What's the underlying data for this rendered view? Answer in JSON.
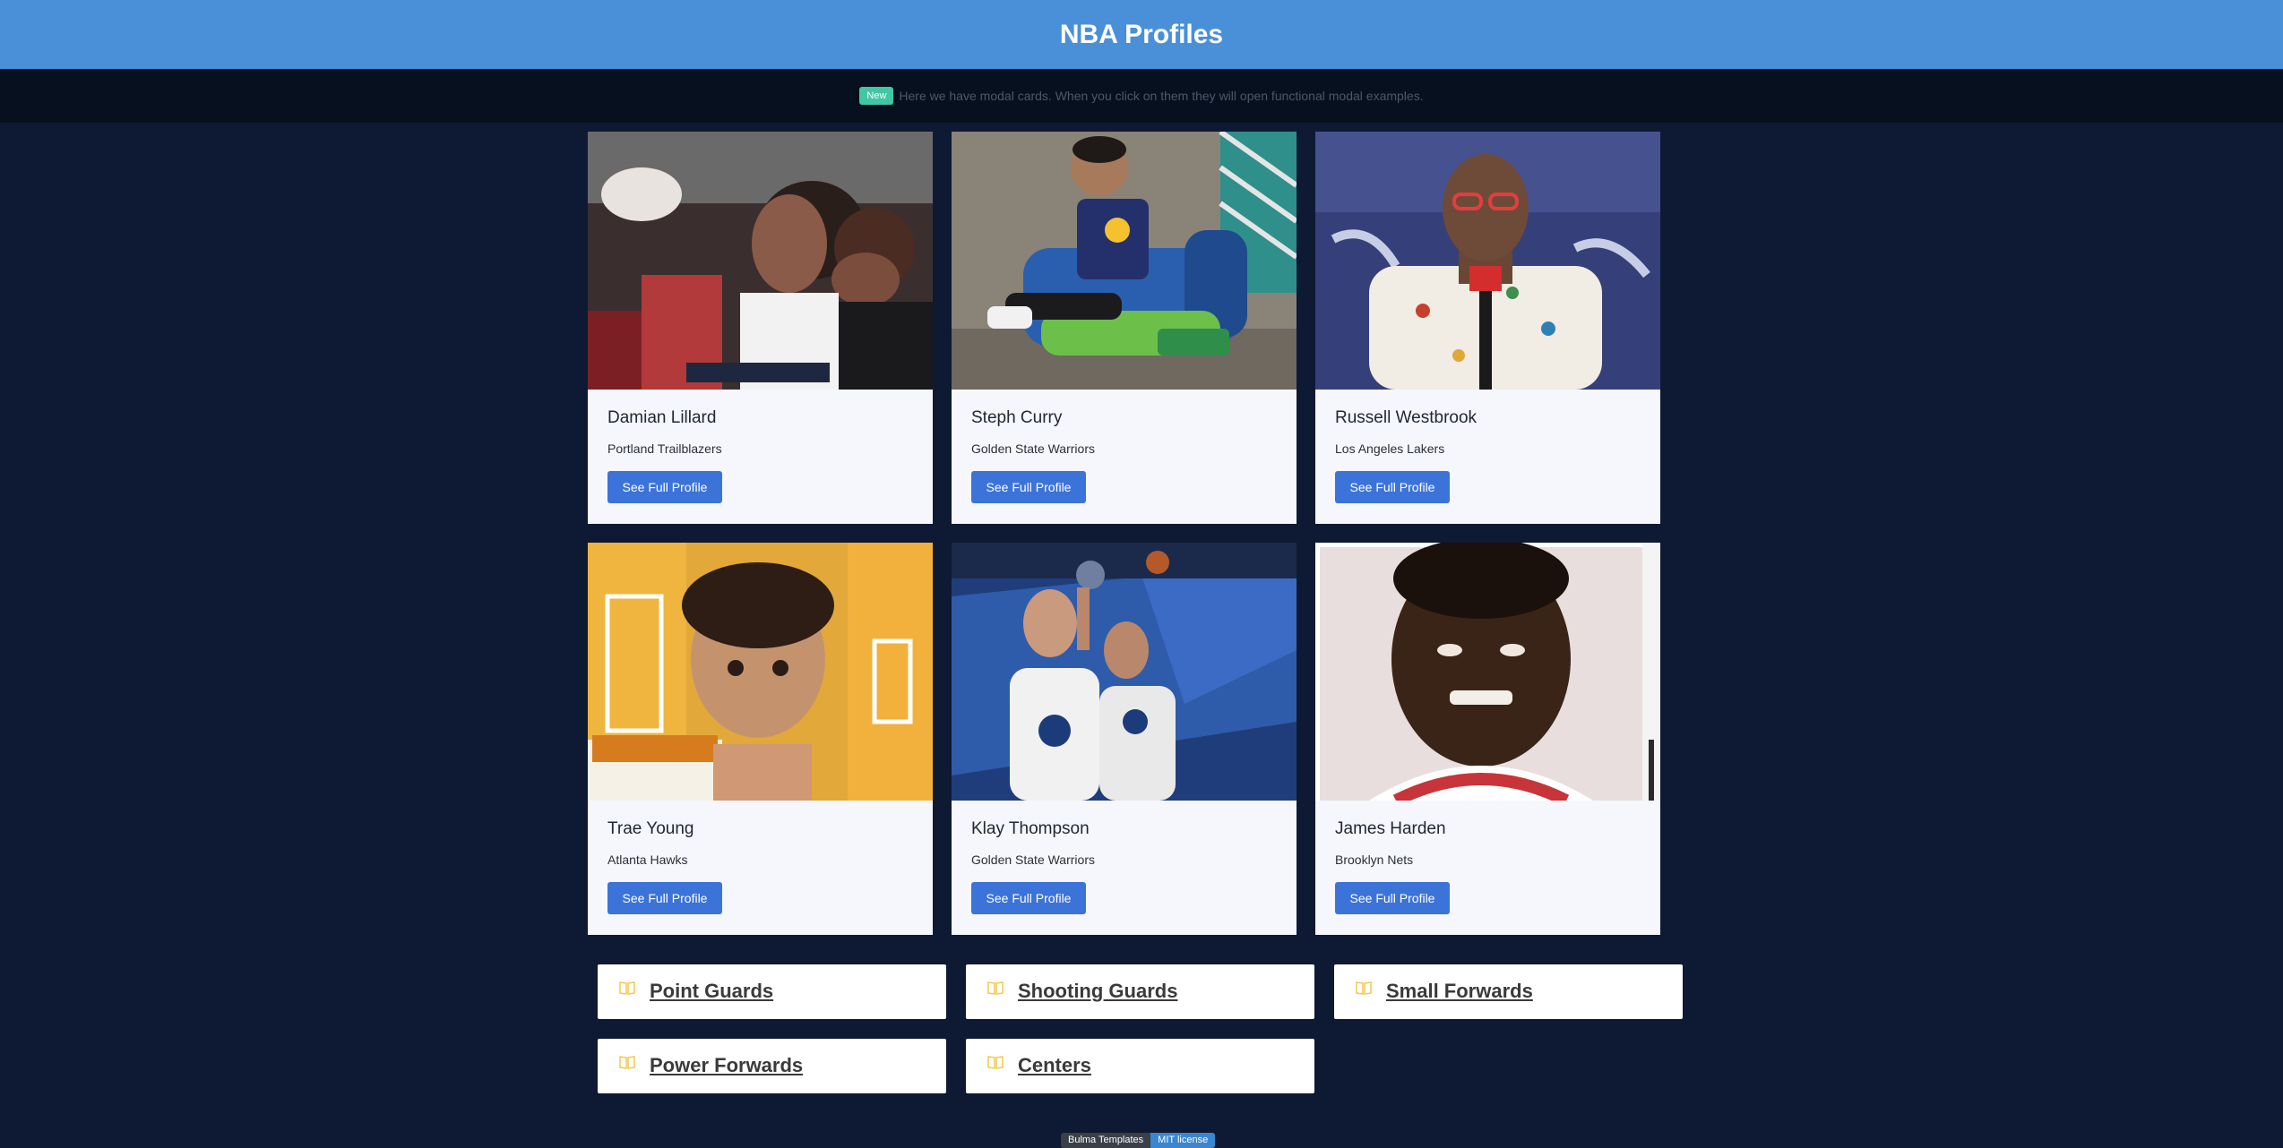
{
  "header": {
    "title": "NBA Profiles"
  },
  "notice": {
    "tag": "New",
    "text": "Here we have modal cards. When you click on them they will open functional modal examples."
  },
  "cards": [
    {
      "name": "Damian Lillard",
      "team": "Portland Trailblazers",
      "button": "See Full Profile"
    },
    {
      "name": "Steph Curry",
      "team": "Golden State Warriors",
      "button": "See Full Profile"
    },
    {
      "name": "Russell Westbrook",
      "team": "Los Angeles Lakers",
      "button": "See Full Profile"
    },
    {
      "name": "Trae Young",
      "team": "Atlanta Hawks",
      "button": "See Full Profile"
    },
    {
      "name": "Klay Thompson",
      "team": "Golden State Warriors",
      "button": "See Full Profile"
    },
    {
      "name": "James Harden",
      "team": "Brooklyn Nets",
      "button": "See Full Profile"
    }
  ],
  "positions": [
    {
      "label": "Point Guards",
      "icon": "book-icon"
    },
    {
      "label": "Shooting Guards",
      "icon": "book-icon"
    },
    {
      "label": "Small Forwards",
      "icon": "book-icon"
    },
    {
      "label": "Power Forwards",
      "icon": "book-icon"
    },
    {
      "label": "Centers",
      "icon": "book-icon"
    }
  ],
  "footer": {
    "left": "Bulma Templates",
    "right": "MIT license"
  },
  "colors": {
    "header": "#4a90d9",
    "background": "#0e1a33",
    "button": "#3b73d8",
    "tag": "#41c7a3",
    "icon": "#f2c94c"
  }
}
